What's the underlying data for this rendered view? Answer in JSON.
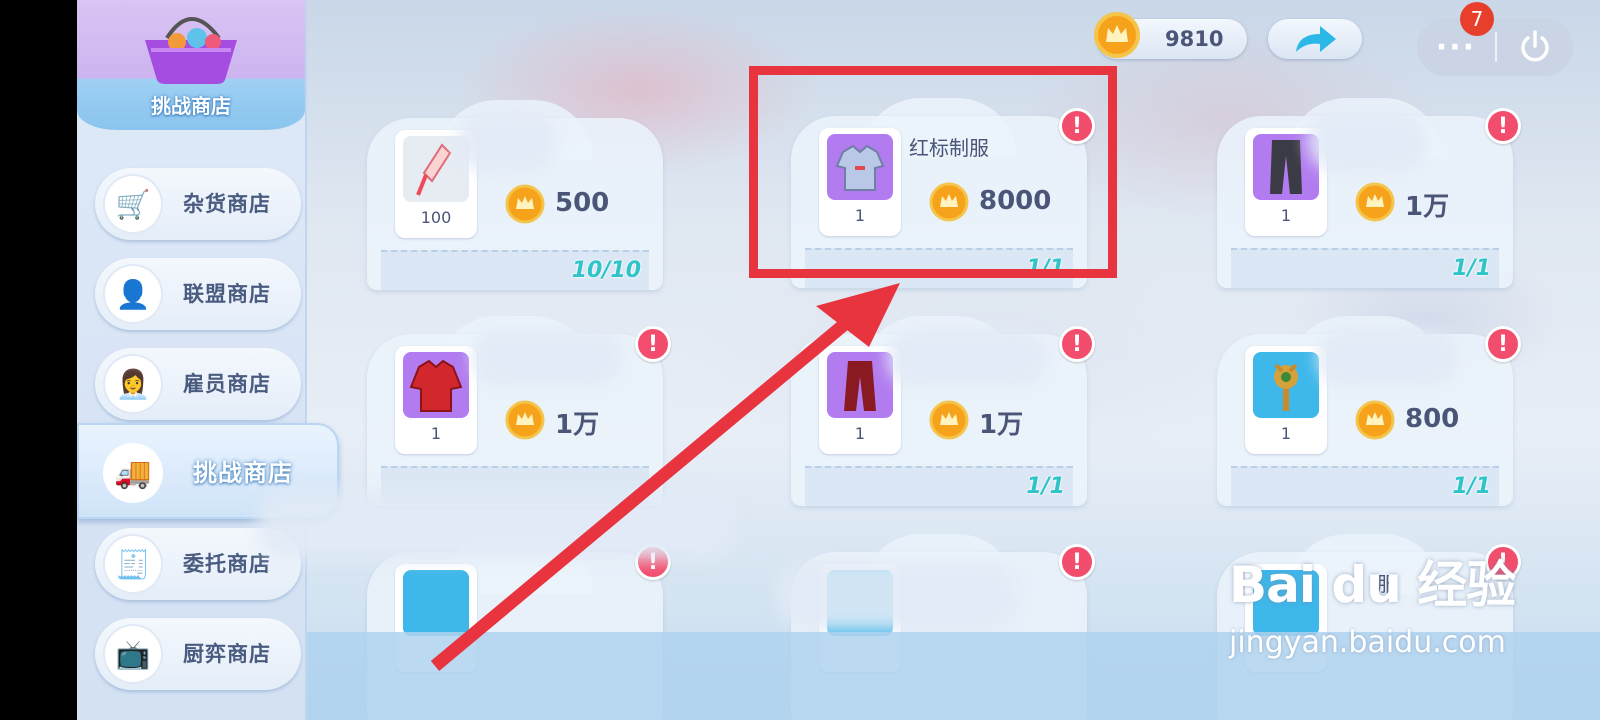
{
  "sidebar": {
    "header_title": "挑战商店",
    "items": [
      {
        "label": "杂货商店",
        "icon": "shopping-cart-icon"
      },
      {
        "label": "联盟商店",
        "icon": "angel-wings-icon"
      },
      {
        "label": "雇员商店",
        "icon": "employee-avatar-icon"
      },
      {
        "label": "挑战商店",
        "icon": "food-truck-icon",
        "active": true
      },
      {
        "label": "委托商店",
        "icon": "cash-register-icon"
      },
      {
        "label": "厨弈商店",
        "icon": "tv-icon"
      }
    ]
  },
  "topbar": {
    "currency_value": "9810",
    "notification_count": "7",
    "more_label": "···"
  },
  "cards": [
    {
      "qty": "100",
      "price": "500",
      "limit": "10/10",
      "name": "",
      "icon": "ketchup-bottle-icon"
    },
    {
      "qty": "1",
      "price": "8000",
      "limit": "1/1",
      "name": "红标制服",
      "icon": "uniform-jacket-icon",
      "alert": "!"
    },
    {
      "qty": "1",
      "price": "1万",
      "limit": "1/1",
      "name": "",
      "icon": "pants-icon",
      "alert": "!"
    },
    {
      "qty": "1",
      "price": "1万",
      "limit": "",
      "name": "",
      "icon": "red-chef-coat-icon",
      "alert": "!"
    },
    {
      "qty": "1",
      "price": "1万",
      "limit": "1/1",
      "name": "",
      "icon": "red-cape-icon",
      "alert": "!"
    },
    {
      "qty": "1",
      "price": "800",
      "limit": "1/1",
      "name": "",
      "icon": "decor-plant-icon",
      "alert": "!"
    },
    {
      "name": "",
      "icon": "plant-icon",
      "alert": "!"
    },
    {
      "name": "",
      "icon": "flower-icon",
      "alert": "!"
    },
    {
      "name": "服",
      "icon": "red-outfit-icon",
      "alert": "!"
    }
  ],
  "watermark": {
    "logo": "Bai du 经验",
    "url": "jingyan.baidu.com"
  },
  "colors": {
    "highlight": "#e8343f",
    "limit_text": "#2fc4c8",
    "alert": "#f34d6e",
    "badge": "#e83f2d"
  }
}
